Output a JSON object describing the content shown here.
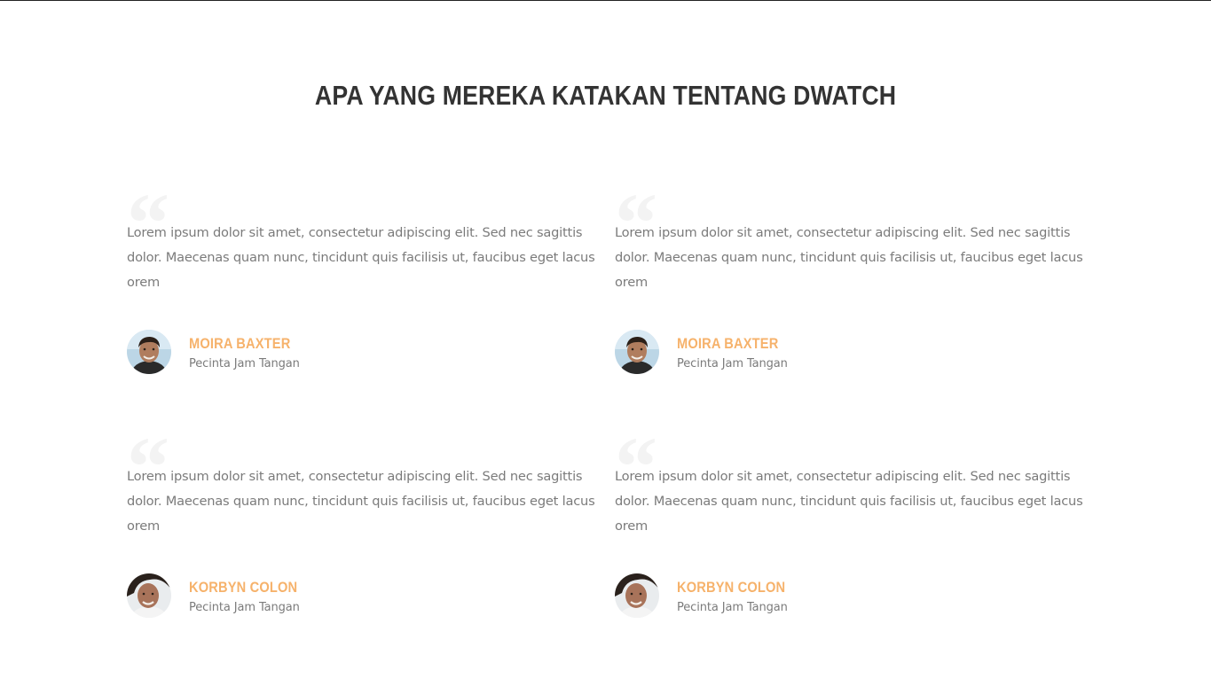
{
  "section": {
    "title": "APA YANG MEREKA KATAKAN TENTANG DWATCH"
  },
  "colors": {
    "accent": "#f6b26b",
    "heading": "#333333",
    "body_text": "#7b7b7b",
    "quote_mark": "#f3f3f3"
  },
  "testimonials": [
    {
      "quote_icon": "quote-open-icon",
      "text": "Lorem ipsum dolor sit amet, consectetur adipiscing elit. Sed nec sagittis dolor. Maecenas quam nunc, tincidunt quis facilisis ut, faucibus eget lacus orem",
      "name": "MOIRA BAXTER",
      "role": "Pecinta Jam Tangan"
    },
    {
      "quote_icon": "quote-open-icon",
      "text": "Lorem ipsum dolor sit amet, consectetur adipiscing elit. Sed nec sagittis dolor. Maecenas quam nunc, tincidunt quis facilisis ut, faucibus eget lacus orem",
      "name": "MOIRA BAXTER",
      "role": "Pecinta Jam Tangan"
    },
    {
      "quote_icon": "quote-open-icon",
      "text": "Lorem ipsum dolor sit amet, consectetur adipiscing elit. Sed nec sagittis dolor. Maecenas quam nunc, tincidunt quis facilisis ut, faucibus eget lacus orem",
      "name": "KORBYN COLON",
      "role": "Pecinta Jam Tangan"
    },
    {
      "quote_icon": "quote-open-icon",
      "text": "Lorem ipsum dolor sit amet, consectetur adipiscing elit. Sed nec sagittis dolor. Maecenas quam nunc, tincidunt quis facilisis ut, faucibus eget lacus orem",
      "name": "KORBYN COLON",
      "role": "Pecinta Jam Tangan"
    }
  ]
}
